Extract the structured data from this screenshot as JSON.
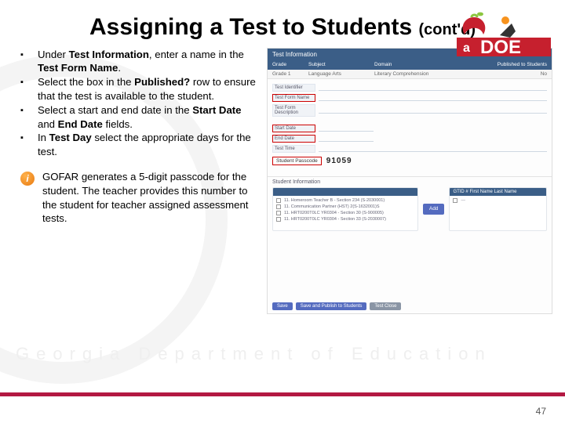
{
  "title_main": "Assigning a Test to Students",
  "title_sub": "(cont'd)",
  "bullets": [
    {
      "pre": "Under ",
      "b1": "Test Information",
      "mid": ", enter a name in the ",
      "b2": "Test Form Name",
      "post": "."
    },
    {
      "pre": "Select the box in the ",
      "b1": "Published?",
      "mid": " row to ensure that the test is available to the student.",
      "b2": "",
      "post": ""
    },
    {
      "pre": "Select a start and end date in the ",
      "b1": "Start Date",
      "mid": " and ",
      "b2": "End Date",
      "post": " fields."
    },
    {
      "pre": "In ",
      "b1": "Test Day",
      "mid": " select the appropriate days for the test.",
      "b2": "",
      "post": ""
    }
  ],
  "note": "GOFAR generates a 5-digit passcode for the student. The teacher provides this number to  the student for teacher assigned assessment tests.",
  "watermark": "Georgia Department of Education",
  "page": "47",
  "screenshot": {
    "heading": "Test Information",
    "cols": {
      "c1": "Grade",
      "c2": "Subject",
      "c3": "Domain",
      "c4": "Published to Students"
    },
    "rowvals": {
      "v1": "Grade 1",
      "v2": "Language Arts",
      "v3": "Literary Comprehension",
      "v4": "No"
    },
    "labels": {
      "id": "Test Identifier",
      "name": "Test Form Name",
      "desc": "Test Form Description",
      "startdate": "Start Date",
      "enddate": "End Date",
      "testtime": "Test Time"
    },
    "passcode_label": "Student Passcode",
    "passcode": "91059",
    "student_h": "Student Information",
    "left_header": "",
    "right_cols": "GTID      #      First Name      Last Name",
    "left_rows": [
      "11.  Homeroom Teacher B - Section 234  (S-2030001)",
      "11.  Communication Partner  (HST) 2(S-1632001)S",
      "11.  HRT0200T0LC YR0304  - Section 30  (S-900005)",
      "11.  HRT0200T0LC YR0304  - Section 33  (S-2030007)"
    ],
    "add_btn": "Add",
    "btns": {
      "save": "Save",
      "publish": "Save and Publish to Students",
      "close": "Test Close"
    }
  }
}
